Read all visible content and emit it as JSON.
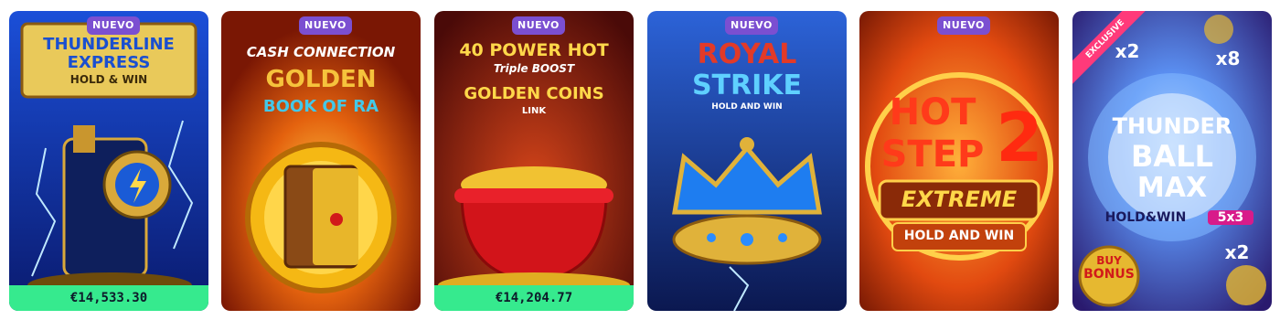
{
  "games": [
    {
      "badge": "NUEVO",
      "title_lines": [
        "THUNDERLINE",
        "EXPRESS",
        "HOLD & WIN"
      ],
      "jackpot": "€14,533.30"
    },
    {
      "badge": "NUEVO",
      "title_lines": [
        "CASH CONNECTION",
        "GOLDEN",
        "BOOK OF RA"
      ],
      "jackpot": ""
    },
    {
      "badge": "NUEVO",
      "title_lines": [
        "40 POWER HOT",
        "Triple BOOST",
        "GOLDEN COINS",
        "LINK"
      ],
      "jackpot": "€14,204.77"
    },
    {
      "badge": "NUEVO",
      "title_lines": [
        "ROYAL",
        "STRIKE",
        "HOLD AND WIN"
      ],
      "jackpot": ""
    },
    {
      "badge": "NUEVO",
      "title_lines": [
        "HOT",
        "STEP",
        "2",
        "EXTREME",
        "HOLD AND WIN"
      ],
      "jackpot": ""
    },
    {
      "ribbon": "EXCLUSIVE",
      "title_lines": [
        "THUNDER",
        "BALL",
        "MAX",
        "HOLD&WIN",
        "5x3"
      ],
      "multipliers": [
        "x2",
        "x8",
        "x2"
      ],
      "bonus_label": [
        "BUY",
        "BONUS"
      ]
    }
  ],
  "colors": {
    "badge": "#7b4fd1",
    "jackpot_bar": "#36ea8e"
  }
}
